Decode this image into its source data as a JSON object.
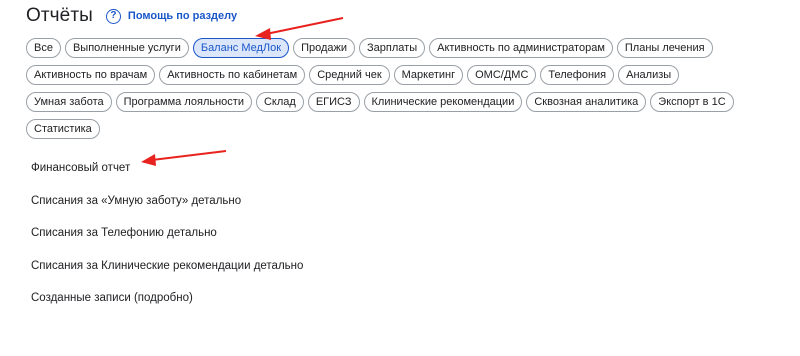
{
  "header": {
    "title": "Отчёты",
    "help_label": "Помощь по разделу",
    "help_icon": "question-circle-icon"
  },
  "filters": {
    "active_index": 2,
    "accent_color": "#1a57c9",
    "active_bg": "#dbe6fb",
    "rows": [
      [
        "Все",
        "Выполненные услуги",
        "Баланс МедЛок",
        "Продажи",
        "Зарплаты",
        "Активность по администраторам",
        "Планы лечения"
      ],
      [
        "Активность по врачам",
        "Активность по кабинетам",
        "Средний чек",
        "Маркетинг",
        "ОМС/ДМС",
        "Телефония",
        "Анализы"
      ],
      [
        "Умная забота",
        "Программа лояльности",
        "Склад",
        "ЕГИСЗ",
        "Клинические рекомендации",
        "Сквозная аналитика",
        "Экспорт в 1С"
      ],
      [
        "Статистика"
      ]
    ]
  },
  "reports": {
    "items": [
      "Финансовый отчет",
      "Списания за «Умную заботу» детально",
      "Списания за Телефонию детально",
      "Списания за Клинические рекомендации детально",
      "Созданные записи (подробно)"
    ]
  },
  "annotations": {
    "arrow_color": "#e8231f"
  }
}
